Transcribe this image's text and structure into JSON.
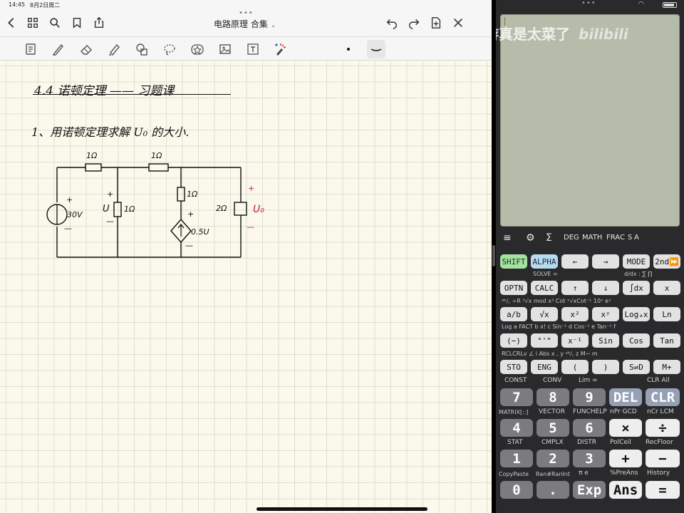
{
  "status": {
    "time": "14:45",
    "date": "8月2日周二"
  },
  "notes_app": {
    "title": "电路原理 合集",
    "top_icons": [
      "back-icon",
      "grid-icon",
      "search-icon",
      "bookmark-icon",
      "share-icon",
      "undo-icon",
      "redo-icon",
      "add-page-icon",
      "close-icon"
    ],
    "tools": [
      "scan-icon",
      "pen-icon",
      "eraser-icon",
      "highlighter-icon",
      "shapes-icon",
      "lasso-icon",
      "star-icon",
      "image-icon",
      "textbox-icon",
      "laser-icon",
      "dot-color-icon",
      "stroke-curve-icon"
    ],
    "page": {
      "heading": "4.4   诺顿定理 —— 习题课",
      "problem": "1、用诺顿定理求解 U₀ 的大小.",
      "circuit_labels": {
        "r_top_left": "1Ω",
        "r_top_right": "1Ω",
        "r_left_mid": "1Ω",
        "r_mid": "1Ω",
        "r_right": "2Ω",
        "source_voltage": "30V",
        "controlled_source": "0.5U",
        "u_label": "U",
        "output_label": "U₀",
        "plus": "+",
        "minus": "—"
      }
    },
    "colors": {
      "ink": "#111111",
      "red_ink": "#c4203c",
      "paper": "#fbf8ec"
    }
  },
  "calculator": {
    "watermark": "老游真是太菜了",
    "watermark_logo": "bilibili",
    "menu": [
      "DEG",
      "MATH",
      "FRAC",
      "S",
      "A"
    ],
    "rows": [
      [
        "SHIFT",
        "ALPHA",
        "←",
        "→",
        "MODE",
        "2nd⏩"
      ],
      [
        "OPTN",
        "CALC",
        "↑",
        "↓",
        "∫dx",
        "x"
      ],
      [
        "a/b",
        "√x",
        "x²",
        "xʸ",
        "Logₐx",
        "Ln"
      ],
      [
        "(−)",
        "°'\"",
        "x⁻¹",
        "Sin",
        "Cos",
        "Tan"
      ],
      [
        "STO",
        "ENG",
        "(",
        ")",
        "S⇌D",
        "M+"
      ]
    ],
    "row_subs": [
      [
        "SOLVE =",
        "d/dx  :   ∑   ∏"
      ],
      [
        "ᵃᵇ/꜀ ÷R  ³√x mod  x³ Cot  ˣ√xCot⁻¹   10ˣ       eˣ"
      ],
      [
        "Log  a   FACT b   x!  c   Sin⁻¹ d  Cos⁻¹ e  Tan⁻¹ f"
      ],
      [
        "RCLCRLv   ∠  i    Abs  x    ,  y    ᵃᵇ/꜀  z   M−  m"
      ]
    ],
    "big_rows": [
      [
        "7",
        "8",
        "9",
        "DEL",
        "CLR"
      ],
      [
        "4",
        "5",
        "6",
        "×",
        "÷"
      ],
      [
        "1",
        "2",
        "3",
        "+",
        "−"
      ],
      [
        "0",
        ".",
        "Exp",
        "Ans",
        "="
      ]
    ],
    "big_labels": [
      [
        "CONST",
        "CONV",
        "Lim  ∞",
        "",
        "CLR All"
      ],
      [
        "MATRIX[::]",
        "VECTOR",
        "FUNCHELP",
        "nPr GCD",
        "nCr LCM"
      ],
      [
        "STAT",
        "CMPLX",
        "DISTR",
        "PolCeil",
        "RecFloor"
      ],
      [
        "CopyPaste",
        "Ran#RanInt",
        "π   e",
        "%PreAns",
        "History"
      ]
    ],
    "colors": {
      "body": "#2a2a2c",
      "lcd": "#b5bdaa",
      "shift": "#a7e1a2",
      "alpha": "#b9d9f0",
      "digit": "#7c7c80"
    }
  }
}
